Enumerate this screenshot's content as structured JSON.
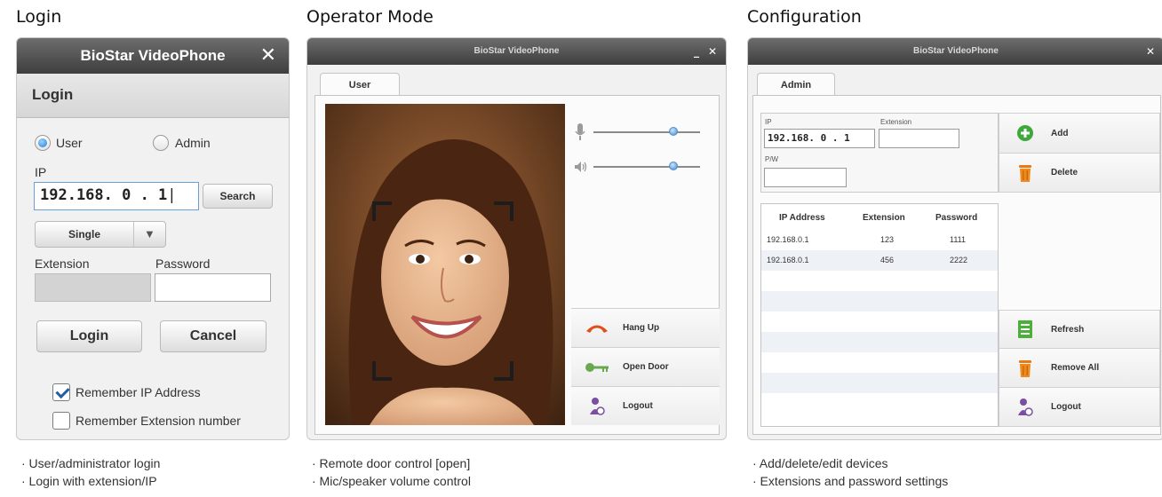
{
  "sections": {
    "login": {
      "heading": "Login",
      "bullets": [
        "· User/administrator login",
        "· Login with extension/IP"
      ]
    },
    "operator": {
      "heading": "Operator Mode",
      "bullets": [
        "· Remote door control [open]",
        "· Mic/speaker volume control"
      ]
    },
    "config": {
      "heading": "Configuration",
      "bullets": [
        "· Add/delete/edit devices",
        "· Extensions and password settings"
      ]
    }
  },
  "login_window": {
    "title": "BioStar VideoPhone",
    "close_glyph": "✕",
    "panel_title": "Login",
    "radio_user": "User",
    "radio_admin": "Admin",
    "selected_role": "User",
    "ip_label": "IP",
    "ip_value": "192.168. 0 . 1",
    "search_button": "Search",
    "mode_value": "Single",
    "extension_label": "Extension",
    "password_label": "Password",
    "login_button": "Login",
    "cancel_button": "Cancel",
    "remember_ip": "Remember IP Address",
    "remember_ip_checked": true,
    "remember_ext": "Remember Extension number",
    "remember_ext_checked": false
  },
  "operator_window": {
    "title": "BioStar VideoPhone",
    "minimize_glyph": "_",
    "close_glyph": "✕",
    "tab": "User",
    "mic_level": 0.75,
    "speaker_level": 0.75,
    "buttons": [
      {
        "label": "Hang Up",
        "icon": "hang-up-icon"
      },
      {
        "label": "Open Door",
        "icon": "key-icon"
      },
      {
        "label": "Logout",
        "icon": "logout-icon"
      }
    ]
  },
  "config_window": {
    "title": "BioStar VideoPhone",
    "close_glyph": "✕",
    "tab": "Admin",
    "ip_label": "IP",
    "ip_value": "192.168. 0 . 1",
    "extension_label": "Extension",
    "password_label": "P/W",
    "columns": [
      "IP Address",
      "Extension",
      "Password"
    ],
    "rows": [
      [
        "192.168.0.1",
        "123",
        "1111"
      ],
      [
        "192.168.0.1",
        "456",
        "2222"
      ]
    ],
    "buttons": {
      "add": "Add",
      "delete": "Delete",
      "refresh": "Refresh",
      "remove_all": "Remove All",
      "logout": "Logout"
    }
  },
  "colors": {
    "titlebar": "#4f4f4f",
    "radio_selected": "#1e7fd6",
    "checkbox_check": "#1e5fa8",
    "add_icon": "#3fa83a",
    "delete_icon": "#f08a1c",
    "hangup_icon": "#e0501e"
  }
}
